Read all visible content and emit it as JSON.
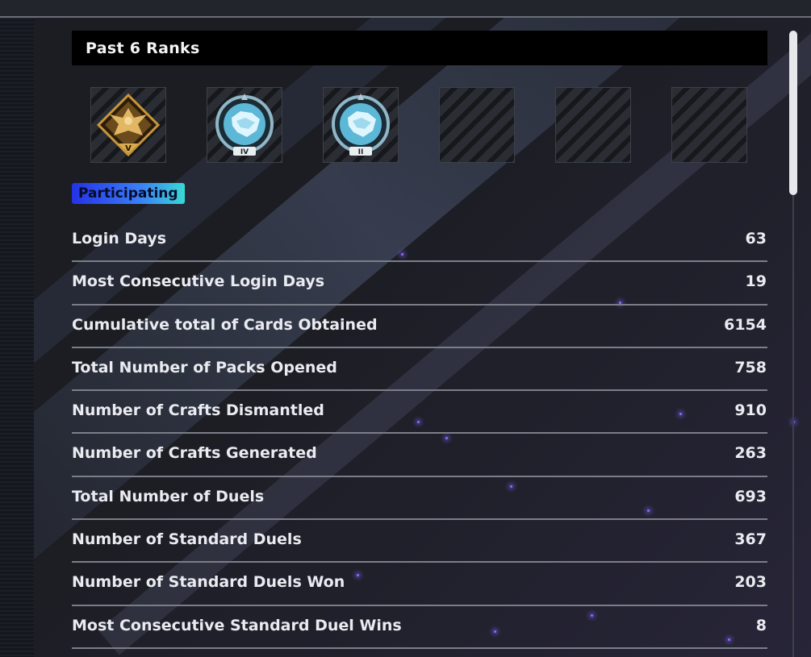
{
  "header": {
    "title": "Past 6 Ranks"
  },
  "ranks": [
    {
      "icon": "gold-rank-v-icon",
      "numeral": "V"
    },
    {
      "icon": "platinum-rank-iv-icon",
      "numeral": "IV"
    },
    {
      "icon": "platinum-rank-ii-icon",
      "numeral": "II"
    },
    {
      "icon": "empty-rank-slot-icon",
      "numeral": ""
    },
    {
      "icon": "empty-rank-slot-icon",
      "numeral": ""
    },
    {
      "icon": "empty-rank-slot-icon",
      "numeral": ""
    }
  ],
  "status_badge": "Participating",
  "stats": [
    {
      "label": "Login Days",
      "value": "63"
    },
    {
      "label": "Most Consecutive Login Days",
      "value": "19"
    },
    {
      "label": "Cumulative total of Cards Obtained",
      "value": "6154"
    },
    {
      "label": "Total Number of Packs Opened",
      "value": "758"
    },
    {
      "label": "Number of Crafts Dismantled",
      "value": "910"
    },
    {
      "label": "Number of Crafts Generated",
      "value": "263"
    },
    {
      "label": "Total Number of Duels",
      "value": "693"
    },
    {
      "label": "Number of Standard Duels",
      "value": "367"
    },
    {
      "label": "Number of Standard Duels Won",
      "value": "203"
    },
    {
      "label": "Most Consecutive Standard Duel Wins",
      "value": "8"
    }
  ],
  "colors": {
    "gold": "#c8963a",
    "platinum": "#8fd6ea",
    "badge_start": "#2432e6",
    "badge_end": "#38d9d4"
  }
}
